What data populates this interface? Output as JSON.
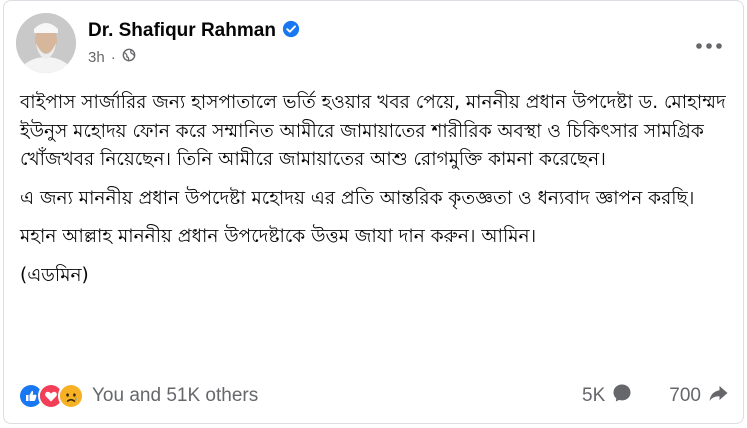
{
  "post": {
    "author": "Dr. Shafiqur Rahman",
    "time": "3h",
    "dot": "·",
    "paragraphs": [
      "বাইপাস সার্জারির জন্য হাসপাতালে ভর্তি হওয়ার খবর পেয়ে, মাননীয় প্রধান উপদেষ্টা ড. মোহাম্মদ ইউনুস মহোদয় ফোন করে সম্মানিত আমীরে জামায়াতের শারীরিক অবস্থা ও চিকিৎসার সামগ্রিক খোঁজখবর নিয়েছেন। তিনি আমীরে জামায়াতের আশু রোগমুক্তি কামনা করেছেন।",
      "এ জন্য মাননীয় প্রধান উপদেষ্টা মহোদয় এর প্রতি আন্তরিক কৃতজ্ঞতা ও ধন্যবাদ জ্ঞাপন করছি।",
      "মহান আল্লাহ মাননীয় প্রধান উপদেষ্টাকে উত্তম জাযা দান করুন। আমিন।",
      "(এডমিন)"
    ]
  },
  "footer": {
    "reactions_text": "You and 51K others",
    "comments": "5K",
    "shares": "700"
  },
  "icons": {
    "verified": "verified-badge-icon",
    "audience": "globe-icon",
    "menu": "more-options-icon",
    "like": "like-reaction-icon",
    "love": "love-reaction-icon",
    "sad": "sad-reaction-icon",
    "comment": "comment-icon",
    "share": "share-icon"
  },
  "colors": {
    "accent": "#1877f2",
    "love": "#f33e58",
    "sad": "#f7b125",
    "muted": "#65676b",
    "text": "#050505"
  }
}
